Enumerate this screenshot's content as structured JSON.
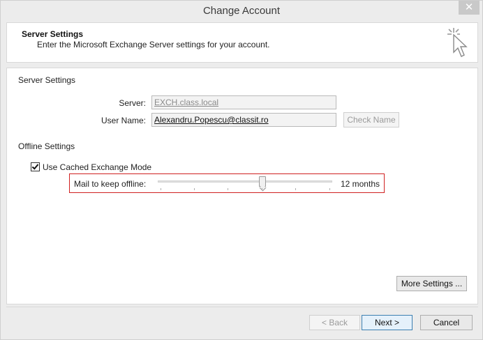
{
  "window": {
    "title": "Change Account",
    "close_glyph": "✕"
  },
  "header": {
    "title": "Server Settings",
    "subtitle": "Enter the Microsoft Exchange Server settings for your account.",
    "icon": "cursor-click-icon"
  },
  "server_settings": {
    "section_label": "Server Settings",
    "server_label": "Server:",
    "server_value": "EXCH.class.local",
    "username_label": "User Name:",
    "username_value": "Alexandru.Popescu@classit.ro",
    "check_name_label": "Check Name"
  },
  "offline_settings": {
    "section_label": "Offline Settings",
    "cached_mode_label": "Use Cached Exchange Mode",
    "cached_mode_checked": true,
    "slider_label": "Mail to keep offline:",
    "slider_value_text": "12 months",
    "slider_fraction": 0.6
  },
  "more_settings_label": "More Settings ...",
  "footer": {
    "back_label": "< Back",
    "next_label": "Next >",
    "cancel_label": "Cancel"
  }
}
